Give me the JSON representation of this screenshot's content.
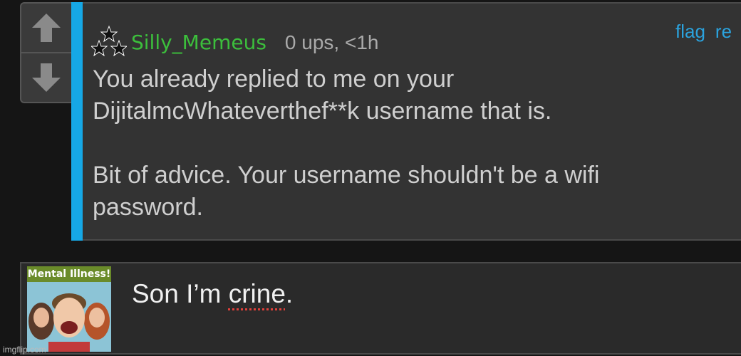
{
  "vote": {
    "up_label": "upvote",
    "down_label": "downvote"
  },
  "comment": {
    "username": "Silly_Memeus",
    "meta": "0 ups, <1h",
    "actions": [
      "flag",
      "re"
    ],
    "body": [
      "You already replied to me on your DijitalmcWhateverthef**k username that is.",
      "Bit of advice. Your username shouldn't be a wifi password."
    ],
    "accent_color": "#16a8e6",
    "username_color": "#3cbf3c"
  },
  "reply": {
    "avatar_banner": "Mental Illness!",
    "text_before": "Son I’m ",
    "misspelled": "crine",
    "text_after": "."
  },
  "watermark": "imgflip.com"
}
